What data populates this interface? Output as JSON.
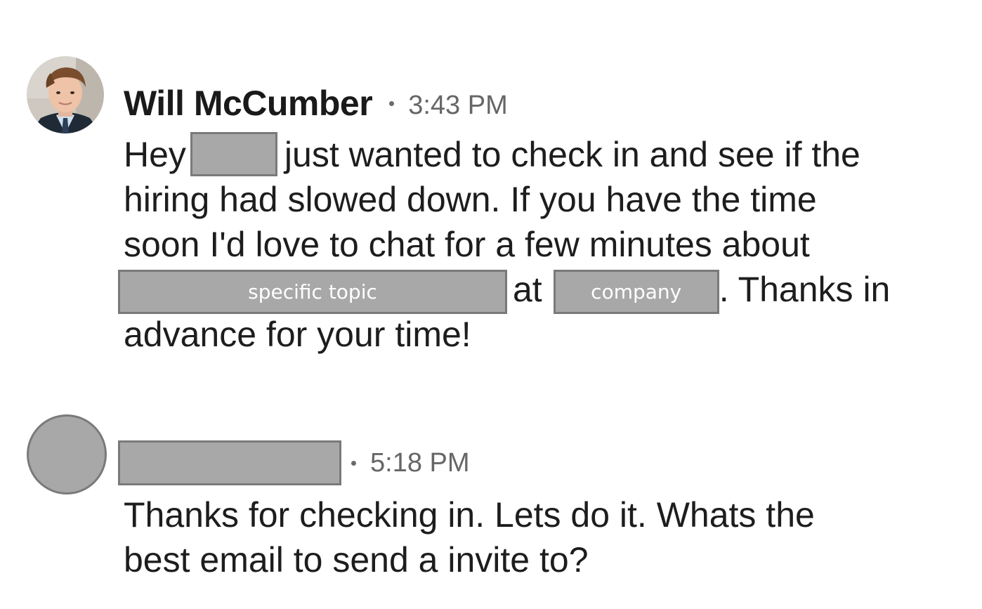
{
  "messages": [
    {
      "sender": "Will McCumber",
      "time": "3:43 PM",
      "avatar": "profile-photo",
      "lines": {
        "l1_a": "Hey",
        "l1_b": "just wanted to check in and see if the",
        "l2": "hiring had slowed down.  If you have the time",
        "l3": "soon I'd love to chat for a few minutes about",
        "l4_at": "at",
        "l4_end": ".  Thanks in",
        "l5": "advance for your time!"
      },
      "redactions": {
        "topic": "specific topic",
        "company": "company"
      }
    },
    {
      "sender": "",
      "time": "5:18 PM",
      "avatar": "placeholder",
      "lines": {
        "l1": "Thanks for checking in. Lets do it. Whats the",
        "l2": "best email to send a invite to?"
      }
    }
  ],
  "colors": {
    "redaction_fill": "#a8a8a8",
    "redaction_border": "#7a7a7a",
    "timestamp": "#666666"
  }
}
